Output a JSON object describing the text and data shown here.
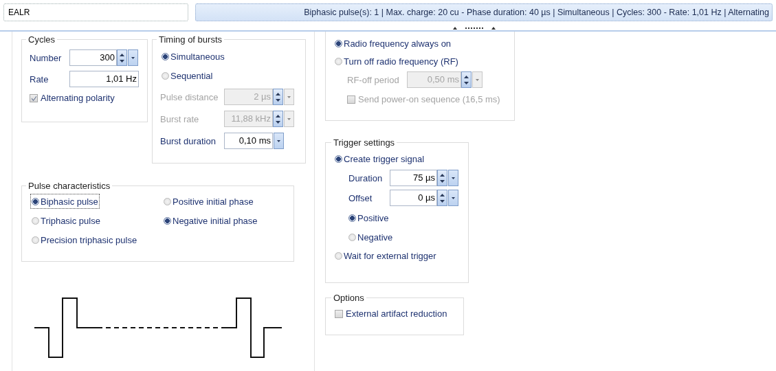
{
  "name_field": {
    "value": "EALR"
  },
  "summary": "Biphasic pulse(s): 1 | Max. charge: 20 cu - Phase duration: 40 µs | Simultaneous | Cycles: 300 - Rate: 1,01 Hz | Alternating",
  "cycles": {
    "title": "Cycles",
    "fields": [
      {
        "label": "Number",
        "value": "300",
        "kind": "spin",
        "disabled": false
      },
      {
        "label": "Rate",
        "value": "1,01 Hz",
        "kind": "text",
        "disabled": false
      }
    ],
    "checks": [
      {
        "label": "Alternating polarity",
        "checked": true,
        "disabled": false
      }
    ]
  },
  "timing": {
    "title": "Timing of bursts",
    "options": [
      {
        "label": "Simultaneous",
        "selected": true
      },
      {
        "label": "Sequential",
        "selected": false
      }
    ],
    "fields": [
      {
        "label": "Pulse distance",
        "value": "2 µs",
        "kind": "spin",
        "disabled": true
      },
      {
        "label": "Burst rate",
        "value": "11,88 kHz",
        "kind": "spin",
        "disabled": true
      },
      {
        "label": "Burst duration",
        "value": "0,10 ms",
        "kind": "dropdown",
        "disabled": false
      }
    ]
  },
  "pulse": {
    "title": "Pulse characteristics",
    "shapes": [
      {
        "label": "Biphasic pulse",
        "selected": true,
        "focused": true
      },
      {
        "label": "Triphasic pulse",
        "selected": false,
        "focused": false
      },
      {
        "label": "Precision triphasic pulse",
        "selected": false,
        "focused": false
      }
    ],
    "phases": [
      {
        "label": "Positive initial phase",
        "selected": false,
        "focused": false
      },
      {
        "label": "Negative initial phase",
        "selected": true,
        "focused": false
      }
    ]
  },
  "rf": {
    "options": [
      {
        "label": "Radio frequency always on",
        "selected": true
      },
      {
        "label": "Turn off radio frequency (RF)",
        "selected": false
      }
    ],
    "fields": [
      {
        "label": "RF-off period",
        "value": "0,50 ms",
        "kind": "spin",
        "disabled": true
      }
    ],
    "checks": [
      {
        "label": "Send power-on sequence (16,5 ms)",
        "checked": false,
        "disabled": true
      }
    ]
  },
  "trigger": {
    "title": "Trigger settings",
    "options": [
      {
        "label": "Create trigger signal",
        "selected": true
      },
      {
        "label": "Wait for external trigger",
        "selected": false
      }
    ],
    "fields": [
      {
        "label": "Duration",
        "value": "75 µs",
        "kind": "spin",
        "disabled": false
      },
      {
        "label": "Offset",
        "value": "0 µs",
        "kind": "spin",
        "disabled": false
      }
    ],
    "edges": [
      {
        "label": "Positive",
        "selected": true
      },
      {
        "label": "Negative",
        "selected": false
      }
    ]
  },
  "options": {
    "title": "Options",
    "checks": [
      {
        "label": "External artifact reduction",
        "checked": false,
        "disabled": false
      }
    ]
  }
}
